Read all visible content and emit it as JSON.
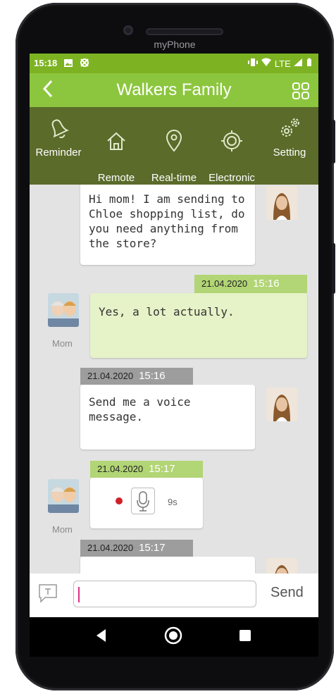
{
  "device": {
    "brand": "myPhone"
  },
  "statusbar": {
    "time": "15:18",
    "network": "LTE"
  },
  "appbar": {
    "title": "Walkers Family"
  },
  "toolbar": {
    "items": [
      {
        "label": "Reminder",
        "icon": "bell-icon"
      },
      {
        "label": "Remote\ncontacts",
        "icon": "home-icon"
      },
      {
        "label": "Real-time\nlocation",
        "icon": "location-pin-icon"
      },
      {
        "label": "Electronic\nfence",
        "icon": "target-icon"
      },
      {
        "label": "Setting",
        "icon": "gears-icon"
      }
    ]
  },
  "messages": [
    {
      "side": "right",
      "text": "Hi mom! I  am sending to Chloe shopping list, do you need anything from the store?"
    },
    {
      "side": "left",
      "date": "21.04.2020",
      "time": "15:16",
      "text": "Yes, a lot actually.",
      "author": "Mom"
    },
    {
      "side": "right",
      "date": "21.04.2020",
      "time": "15:16",
      "text": "Send me a voice message."
    },
    {
      "side": "left",
      "date": "21.04.2020",
      "time": "15:17",
      "voice_duration": "9s",
      "author": "Mom"
    },
    {
      "side": "right",
      "date": "21.04.2020",
      "time": "15:17"
    }
  ],
  "input": {
    "send_label": "Send",
    "value": ""
  },
  "colors": {
    "statusbar": "#7db322",
    "appbar": "#8cc63e",
    "toolbar": "#5a6b2a",
    "chat_bg": "#e3e3e3"
  }
}
